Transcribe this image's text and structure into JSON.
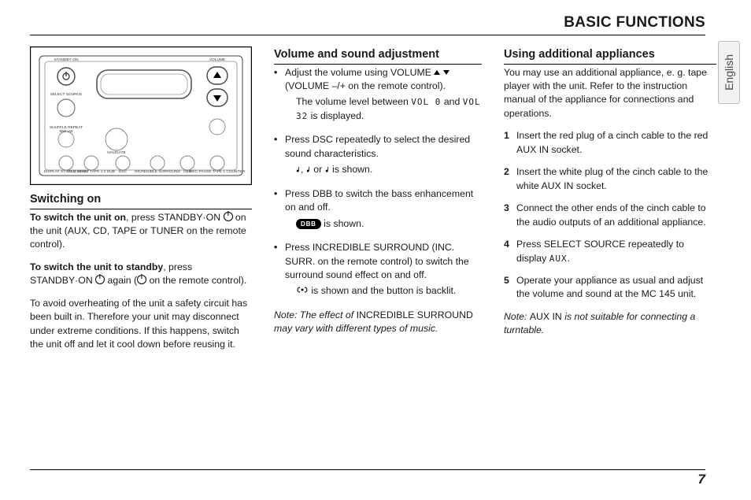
{
  "header": {
    "title": "BASIC FUNCTIONS"
  },
  "tab_label": "English",
  "page_number": "7",
  "col1": {
    "heading": "Switching on",
    "p1_bold": "To switch the unit on",
    "p1_rest": ", press STANDBY·ON ",
    "p1_tail": " on the unit (AUX, CD, TAPE or TUNER on the remote control).",
    "p2_bold": "To switch the unit to standby",
    "p2_rest": ", press STANDBY·ON ",
    "p2_tail": " again (",
    "p2_tail2": " on the remote control).",
    "p3": "To avoid overheating of the unit a safety circuit has been built in. Therefore your unit may disconnect under extreme conditions. If this happens, switch the unit off and let it cool down before reusing it."
  },
  "col2": {
    "heading": "Volume and sound adjustment",
    "b1_line": "Adjust the volume using VOLUME ",
    "b1_line2": " (VOLUME –/+ on the remote control).",
    "b1_sub_pre": "The volume level between ",
    "b1_sub_vol0": "VOL   0",
    "b1_sub_mid": " and ",
    "b1_sub_vol32": "VOL  32",
    "b1_sub_tail": " is displayed.",
    "b2_line": "Press DSC repeatedly to select the desired sound characteristics.",
    "b2_sub": ", ",
    "b2_sub_or": " or ",
    "b2_sub_tail": " is shown.",
    "b3_line": "Press DBB to switch the bass enhancement on and off.",
    "b3_pill": "DBB",
    "b3_sub": " is shown.",
    "b4_line": "Press INCREDIBLE SURROUND (INC. SURR. on the remote control) to switch the surround sound effect on and off.",
    "b4_sub": " is shown and the button is backlit.",
    "note_pre": "Note: The effect of ",
    "note_mid": "INCREDIBLE SURROUND",
    "note_tail": " may vary with different types of music."
  },
  "col3": {
    "heading": "Using additional appliances",
    "intro": "You may use an additional appliance, e. g. tape player with the unit. Refer to the instruction manual of the appliance for connections and operations.",
    "s1": "Insert the red plug of a cinch cable to the red AUX IN socket.",
    "s2": "Insert the white plug of the cinch cable to the white AUX IN socket.",
    "s3": "Connect the other ends of the cinch cable to the audio outputs of an additional appliance.",
    "s4_pre": "Press SELECT SOURCE repeatedly to display ",
    "s4_lcd": "AUX",
    "s4_post": ".",
    "s5": "Operate your appliance as usual and adjust the volume and sound at the MC 145 unit.",
    "note_pre": "Note: ",
    "note_mid": "AUX IN",
    "note_tail": " is not suitable for connecting a turntable."
  },
  "figure_labels": {
    "standby": "STANDBY·ON",
    "volume": "VOLUME",
    "select_source": "SELECT SOURCE",
    "shuffle": "SHUFFLE REPEAT",
    "mwlw": "MW·LW",
    "navigate": "NAVIGATE",
    "display": "DISPLAY SYSTEM MENU",
    "dsc": "DSC",
    "inc": "INCREDIBLE SURROUND",
    "dbb": "DBB",
    "recstart": "REC·START TAPE 1∙2 DUB",
    "tapecounter": "REC·PAUSE TAPE 1 COUNTER"
  }
}
